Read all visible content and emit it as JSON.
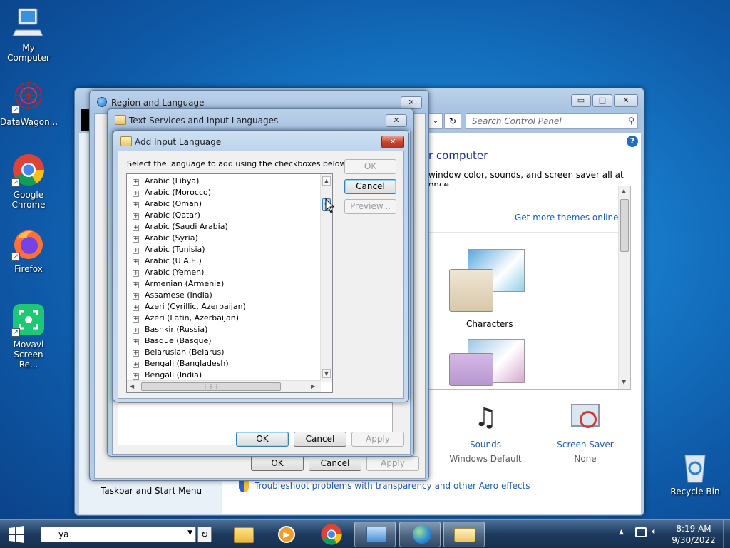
{
  "desktop": {
    "icons": [
      {
        "label": "My Computer"
      },
      {
        "label": "DataWagon..."
      },
      {
        "label": "Google Chrome"
      },
      {
        "label": "Firefox"
      },
      {
        "label": "Movavi Screen Re..."
      },
      {
        "label": "Recycle Bin"
      }
    ]
  },
  "control_panel": {
    "search_placeholder": "Search Control Panel",
    "heading_partial": "r computer",
    "subtitle_partial": "window color, sounds, and screen saver all at once.",
    "get_more_themes": "Get more themes online",
    "theme_label": "Characters",
    "sounds_label": "Sounds",
    "sounds_value": "Windows Default",
    "screensaver_label": "Screen Saver",
    "screensaver_value": "None",
    "taskbar_link": "Taskbar and Start Menu",
    "troubleshoot_link": "Troubleshoot problems with transparency and other Aero effects"
  },
  "region_dialog": {
    "title": "Region and Language",
    "ok": "OK",
    "cancel": "Cancel",
    "apply": "Apply"
  },
  "text_services_dialog": {
    "title": "Text Services and Input Languages",
    "ok": "OK",
    "cancel": "Cancel",
    "apply": "Apply"
  },
  "add_input_dialog": {
    "title": "Add Input Language",
    "instruction": "Select the language to add using the checkboxes below.",
    "ok": "OK",
    "cancel": "Cancel",
    "preview": "Preview...",
    "languages": [
      "Arabic (Libya)",
      "Arabic (Morocco)",
      "Arabic (Oman)",
      "Arabic (Qatar)",
      "Arabic (Saudi Arabia)",
      "Arabic (Syria)",
      "Arabic (Tunisia)",
      "Arabic (U.A.E.)",
      "Arabic (Yemen)",
      "Armenian (Armenia)",
      "Assamese (India)",
      "Azeri (Cyrillic, Azerbaijan)",
      "Azeri (Latin, Azerbaijan)",
      "Bashkir (Russia)",
      "Basque (Basque)",
      "Belarusian (Belarus)",
      "Bengali (Bangladesh)",
      "Bengali (India)"
    ]
  },
  "taskbar": {
    "search_value": "ya",
    "time": "8:19 AM",
    "date": "9/30/2022"
  }
}
